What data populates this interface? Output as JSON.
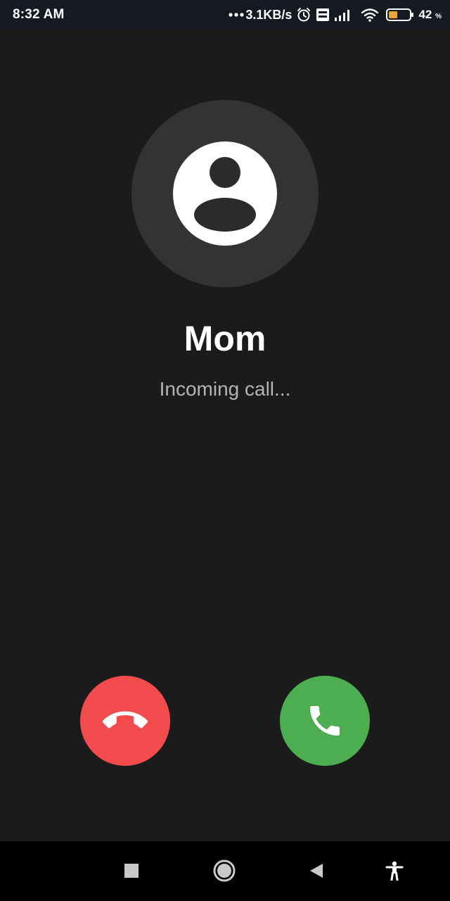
{
  "status_bar": {
    "time": "8:32 AM",
    "net_speed": "3.1KB/s",
    "battery_percent": "42",
    "battery_unit": "%",
    "battery_level": 0.42,
    "icons": [
      "more-dots-icon",
      "alarm-icon",
      "volte-icon",
      "signal-icon",
      "wifi-icon",
      "battery-icon"
    ]
  },
  "caller": {
    "name": "Mom",
    "status": "Incoming call..."
  },
  "actions": {
    "decline": {
      "icon": "hang-up-icon",
      "color": "#f44b4f"
    },
    "accept": {
      "icon": "phone-icon",
      "color": "#4cae50"
    }
  },
  "nav_bar": {
    "icons": [
      "recents-square-icon",
      "home-circle-icon",
      "back-triangle-icon",
      "accessibility-icon"
    ]
  },
  "colors": {
    "background": "#1b1b1b",
    "avatar_ring": "#333333",
    "status_text": "#b4b4b4"
  }
}
